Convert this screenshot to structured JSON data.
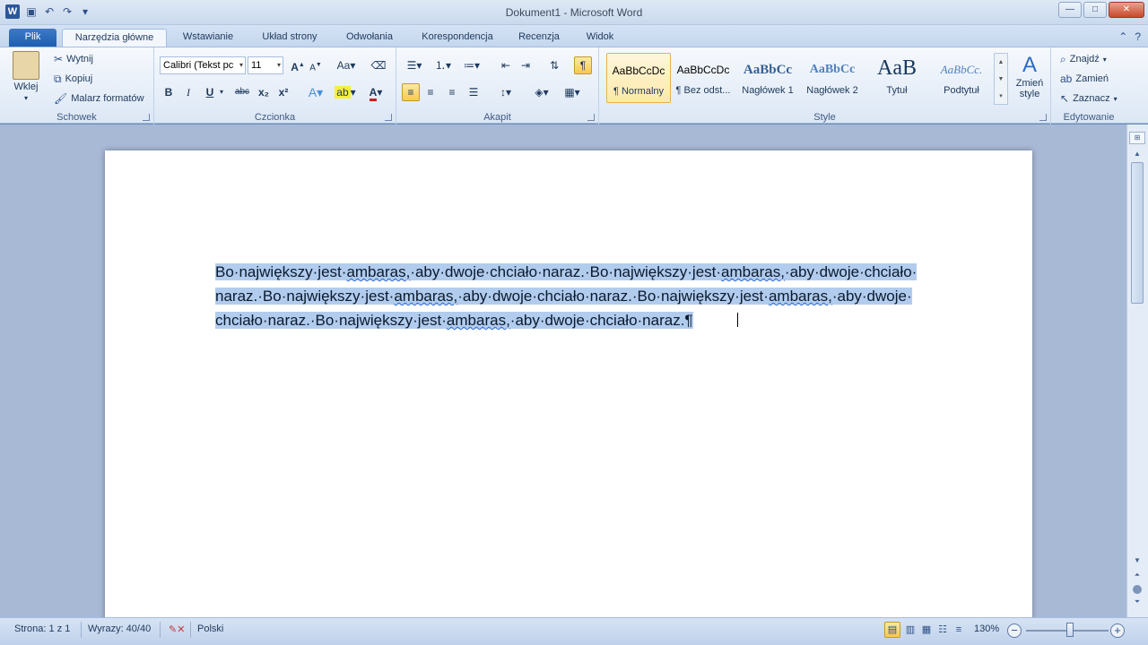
{
  "window": {
    "title": "Dokument1  -  Microsoft Word",
    "app_icon": "W",
    "qat": [
      "save-icon",
      "undo-icon",
      "redo-icon",
      "customize-icon"
    ],
    "controls": {
      "minimize": "—",
      "maximize": "□",
      "close": "✕"
    }
  },
  "tabs": {
    "file": "Plik",
    "items": [
      "Narzędzia główne",
      "Wstawianie",
      "Układ strony",
      "Odwołania",
      "Korespondencja",
      "Recenzja",
      "Widok"
    ],
    "active": "Narzędzia główne"
  },
  "ribbon": {
    "clipboard": {
      "label": "Schowek",
      "paste": "Wklej",
      "cut": "Wytnij",
      "copy": "Kopiuj",
      "format_painter": "Malarz formatów"
    },
    "font": {
      "label": "Czcionka",
      "font_name": "Calibri (Tekst pc",
      "font_size": "11",
      "buttons": [
        "B",
        "I",
        "U",
        "abc",
        "x₂",
        "x²"
      ]
    },
    "paragraph": {
      "label": "Akapit",
      "show_marks": "¶"
    },
    "styles": {
      "label": "Style",
      "items": [
        {
          "sample": "AaBbCcDc",
          "name": "¶ Normalny"
        },
        {
          "sample": "AaBbCcDc",
          "name": "¶ Bez odst..."
        },
        {
          "sample": "AaBbCc",
          "name": "Nagłówek 1"
        },
        {
          "sample": "AaBbCc",
          "name": "Nagłówek 2"
        },
        {
          "sample": "AaB",
          "name": "Tytuł"
        },
        {
          "sample": "AaBbCc.",
          "name": "Podtytuł"
        }
      ],
      "change_styles": "Zmień style"
    },
    "editing": {
      "label": "Edytowanie",
      "find": "Znajdź",
      "replace": "Zamień",
      "select": "Zaznacz"
    }
  },
  "document": {
    "lines": [
      [
        "Bo·największy·jest·",
        "ambaras,",
        "·aby·dwoje·chciało·naraz.·Bo·największy·jest·",
        "ambaras,",
        "·aby·dwoje·chciało·"
      ],
      [
        "naraz.·Bo·największy·jest·",
        "ambaras,",
        "·aby·dwoje·chciało·naraz.·Bo·największy·jest·",
        "ambaras,",
        "·aby·dwoje·"
      ],
      [
        "chciało·naraz.·Bo·największy·jest·",
        "ambaras,",
        "·aby·dwoje·chciało·naraz.¶"
      ]
    ]
  },
  "statusbar": {
    "page": "Strona: 1 z 1",
    "words": "Wyrazy: 40/40",
    "language": "Polski",
    "zoom": "130%",
    "zoom_percent": 130
  }
}
